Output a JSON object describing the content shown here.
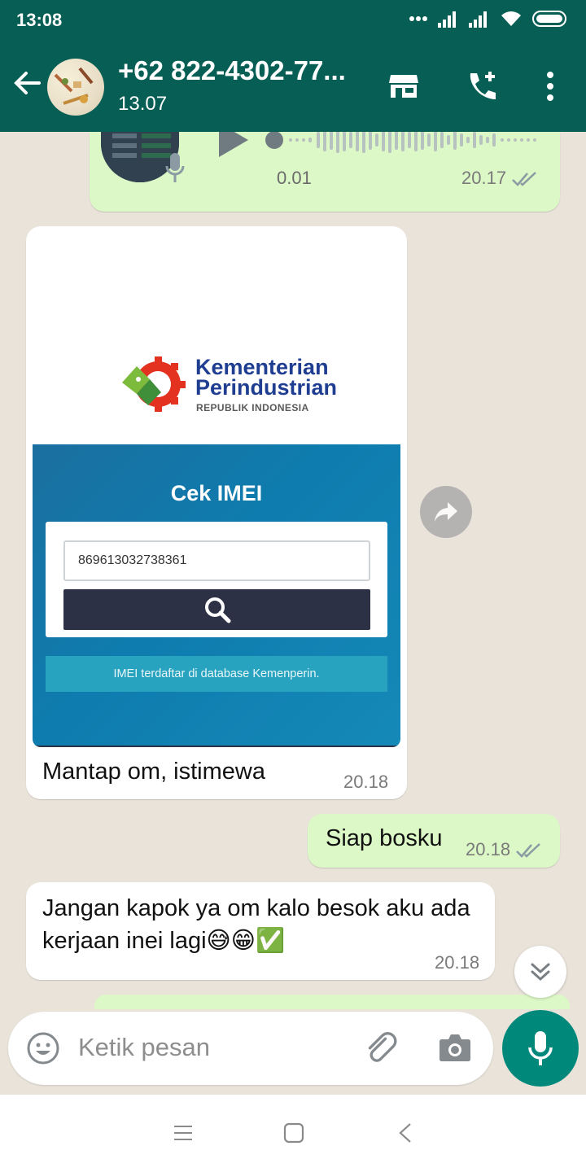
{
  "status_bar": {
    "time": "13:08"
  },
  "header": {
    "contact_name": "+62 822-4302-77...",
    "last_seen": "13.07"
  },
  "messages": {
    "voice": {
      "duration": "0.01",
      "time": "20.17"
    },
    "image": {
      "logo_line1": "Kementerian",
      "logo_line2": "Perindustrian",
      "logo_line3": "REPUBLIK INDONESIA",
      "page_title": "Cek IMEI",
      "imei_value": "869613032738361",
      "alert_text": "IMEI terdaftar di database Kemenperin.",
      "caption": "Mantap om, istimewa",
      "time": "20.18"
    },
    "siap": {
      "text": "Siap bosku",
      "time": "20.18"
    },
    "jangan": {
      "text": "Jangan kapok ya om kalo besok aku ada kerjaan inei lagi😅😁✅",
      "time": "20.18"
    }
  },
  "composer": {
    "placeholder": "Ketik pesan"
  },
  "colors": {
    "header": "#075e54",
    "outgoing_bubble": "#dcf8c6",
    "incoming_bubble": "#ffffff",
    "fab": "#00897b",
    "chat_bg": "#e9e3da"
  }
}
